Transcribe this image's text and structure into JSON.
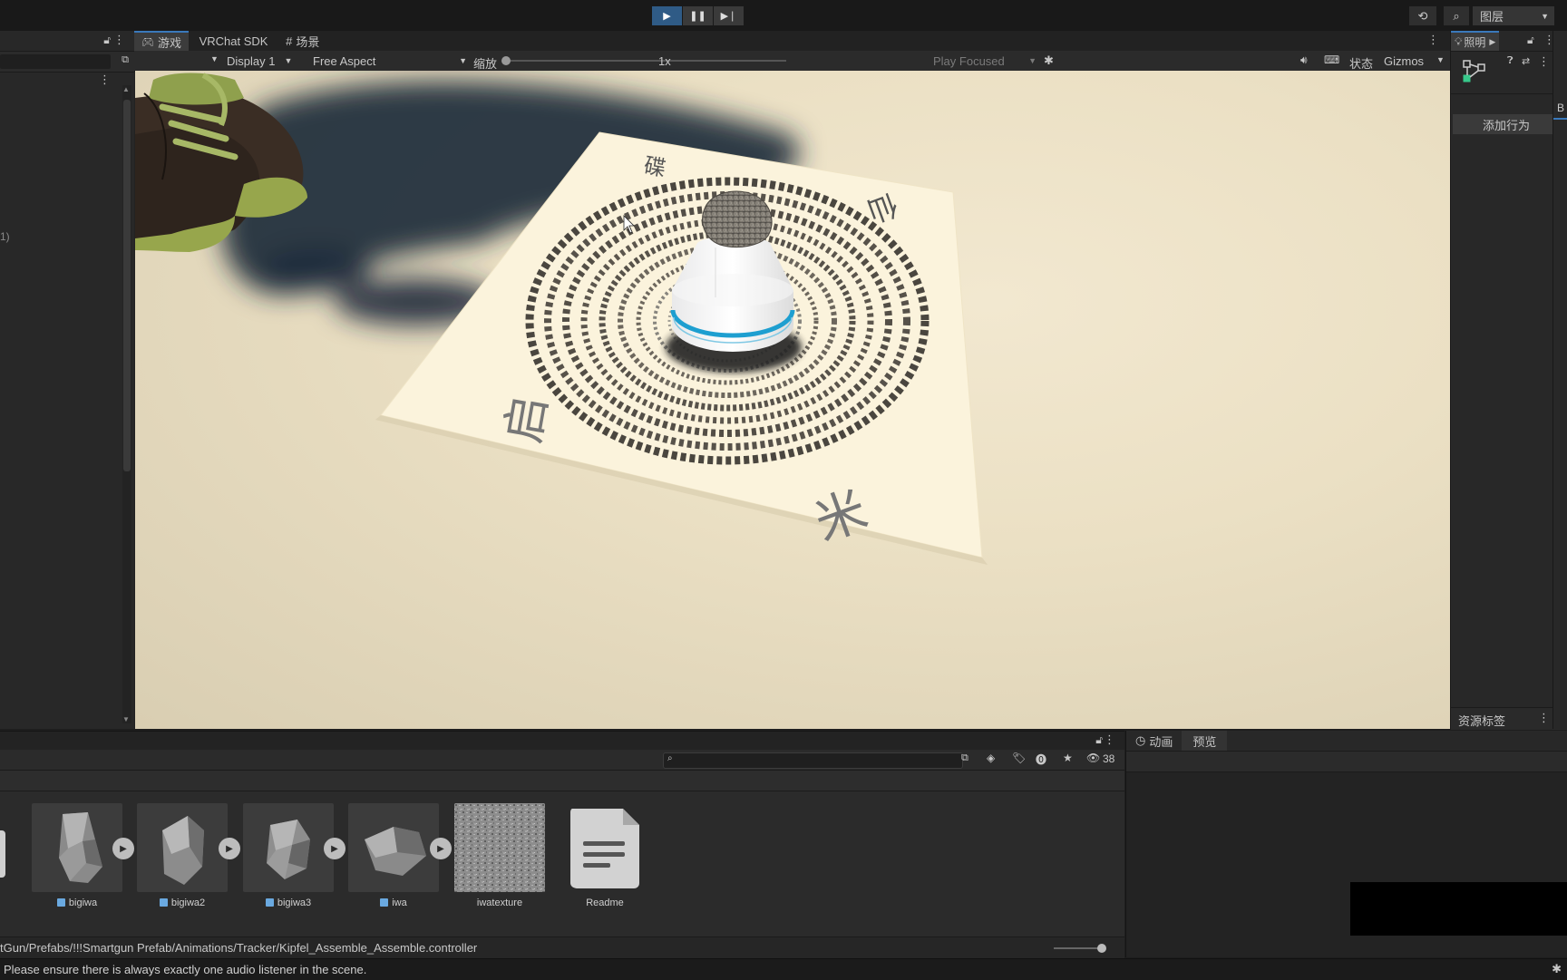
{
  "top_toolbar": {
    "play_icon": "play-icon",
    "pause_icon": "pause-icon",
    "step_icon": "step-icon",
    "history_icon": "history-icon",
    "search_icon": "search-icon",
    "layers_label": "图层"
  },
  "left_panel": {
    "partial_text": "1)"
  },
  "game_tabs": [
    {
      "label": "游戏",
      "icon": "gamepad-icon"
    },
    {
      "label": "VRChat SDK"
    },
    {
      "label": "场景",
      "icon": "hash-icon"
    }
  ],
  "game_toolbar": {
    "display": "Display 1",
    "aspect": "Free Aspect",
    "scale_label": "缩放",
    "scale_value": "1x",
    "play_mode": "Play Focused",
    "status_label": "状态",
    "gizmos_label": "Gizmos"
  },
  "viewport": {
    "corner_glyphs": [
      "碟",
      "仙",
      "启",
      "米"
    ]
  },
  "inspector": {
    "tab_label": "照明",
    "add_behaviour": "添加行为",
    "asset_labels": "资源标签",
    "partial_tab": "B"
  },
  "project": {
    "hidden_count": "38",
    "assets": [
      {
        "name": "bigiwa",
        "prefab": true
      },
      {
        "name": "bigiwa2",
        "prefab": true
      },
      {
        "name": "bigiwa3",
        "prefab": true
      },
      {
        "name": "iwa",
        "prefab": true
      },
      {
        "name": "iwatexture",
        "prefab": false
      },
      {
        "name": "Readme",
        "prefab": false
      }
    ],
    "path": "tGun/Prefabs/!!!Smartgun Prefab/Animations/Tracker/Kipfel_Assemble_Assemble.controller"
  },
  "animation_panel": {
    "tabs": [
      "动画",
      "预览"
    ]
  },
  "status_bar": {
    "message": "Please ensure there is always exactly one audio listener in the scene."
  },
  "colors": {
    "accent": "#3a79bb",
    "play_active": "#2f5b86",
    "cylinder_stripe": "#1e9fd0",
    "paper": "#fbf3dc"
  }
}
